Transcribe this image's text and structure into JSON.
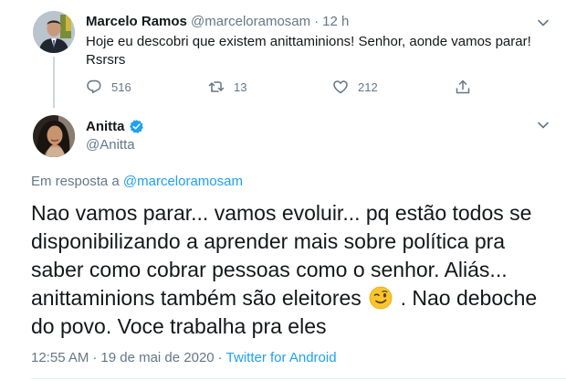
{
  "parent_tweet": {
    "name": "Marcelo Ramos",
    "handle": "@marceloramosam",
    "separator": "·",
    "time": "12 h",
    "text": "Hoje eu descobri que existem anittaminions! Senhor, aonde vamos parar! Rsrsrs",
    "replies": "516",
    "retweets": "13",
    "likes": "212"
  },
  "main_tweet": {
    "name": "Anitta",
    "handle": "@Anitta",
    "reply_prefix": "Em resposta a",
    "reply_to": "@marceloramosam",
    "text_before_emoji": "Nao vamos parar... vamos evoluir... pq estão todos se disponibilizando a aprender mais sobre política pra saber como cobrar pessoas como o senhor. Aliás... anittaminions também são eleitores",
    "emoji": "winking-face",
    "text_after_emoji": " . Nao deboche do povo. Voce trabalha pra eles",
    "time": "12:55 AM",
    "date": "19 de mai de 2020",
    "meta_separator": "·",
    "source": "Twitter for Android"
  },
  "colors": {
    "text_primary": "#14171a",
    "text_secondary": "#657786",
    "link": "#1da1f2",
    "verified": "#1da1f2",
    "divider": "#e6ecf0"
  }
}
